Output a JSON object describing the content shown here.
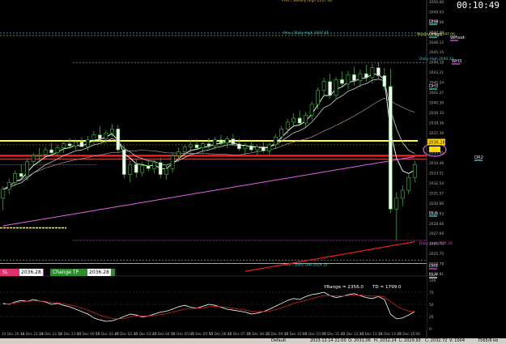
{
  "window": {
    "clock": "00:10:49",
    "header_label": "Prev / Weekly High 2037.06"
  },
  "price_levels": [
    {
      "label": "Prev / Daily High 2047.31",
      "color": "#3ec9c9"
    },
    {
      "label": "Weekly High 2047.06",
      "color": "#c8c832"
    },
    {
      "label": "Daily High 2044.33",
      "color": "#3ec9c9"
    },
    {
      "label": "Daily Low 2026.33",
      "color": "#e040e0"
    },
    {
      "label": "Prev / Daily Low 2024.33",
      "color": "#3ec9c9"
    }
  ],
  "pivot_labels": [
    {
      "label": "DH4"
    },
    {
      "label": "DHigh"
    },
    {
      "label": "WPivot"
    },
    {
      "label": "WH3"
    },
    {
      "label": "DH3"
    },
    {
      "label": "DR2"
    },
    {
      "label": "DL3"
    },
    {
      "label": "DR6"
    },
    {
      "label": "DL4"
    }
  ],
  "price_axis": {
    "ticks": [
      "2050.00",
      "2049.03",
      "2048.06",
      "2047.09",
      "2046.12",
      "2045.15",
      "2044.18",
      "2043.21",
      "2042.24",
      "2041.27",
      "2040.30",
      "2039.33",
      "2038.36",
      "2037.39",
      "2036.42",
      "2035.45",
      "2034.48",
      "2033.51",
      "2032.54",
      "2031.57",
      "2030.60",
      "2029.63",
      "2028.66",
      "2027.69",
      "2026.72",
      "2025.75",
      "2024.78",
      "2023.81"
    ],
    "current_price": "2036.28"
  },
  "orders": {
    "sl_label": "SL",
    "sl_price": "2036.28",
    "tp_label": "Change TP",
    "tp_price": "2036.28"
  },
  "indicator": {
    "range_text": "YRange = 2356.0",
    "td_text": "TD = 1799.0",
    "ticks": [
      "100",
      "75",
      "50",
      "25",
      "0"
    ]
  },
  "time_axis": [
    "14 Dec 20:30",
    "14 Dec 21:20",
    "14 Dec 22:10",
    "14 Dec 23:00",
    "15 Dec 00:50",
    "15 Dec 01:40",
    "15 Dec 02:30",
    "15 Dec 03:20",
    "15 Dec 04:10",
    "15 Dec 05:00",
    "15 Dec 05:50",
    "15 Dec 06:40",
    "15 Dec 07:30",
    "15 Dec 08:20",
    "15 Dec 09:10",
    "15 Dec 10:00",
    "15 Dec 10:50",
    "15 Dec 11:40",
    "15 Dec 12:30",
    "15 Dec 13:20",
    "15 Dec 14:10",
    "15 Dec 15:00"
  ],
  "status_bar": {
    "profile": "Default",
    "datetime": "2023.12.14 21:00",
    "open": "O: 2031.06",
    "high": "H: 2032.24",
    "low": "L: 2029.93",
    "close": "C: 2032.72",
    "volume": "V: 1004",
    "traffic": "7565/6 kb"
  },
  "chart_data": {
    "type": "candlestick",
    "series_note_colors": {
      "ema_fast": "#ffffff",
      "ema_slow": "#cccccc",
      "ma_long": "#e060e0",
      "ma_xlong": "#ff2020"
    },
    "ylim": [
      2023.3,
      2050.0
    ],
    "candles": [
      {
        "o": 2030.6,
        "h": 2031.8,
        "l": 2029.4,
        "c": 2031.5
      },
      {
        "o": 2031.5,
        "h": 2032.6,
        "l": 2031.0,
        "c": 2032.2
      },
      {
        "o": 2032.2,
        "h": 2033.4,
        "l": 2031.8,
        "c": 2033.1
      },
      {
        "o": 2033.1,
        "h": 2034.0,
        "l": 2032.5,
        "c": 2032.8
      },
      {
        "o": 2032.8,
        "h": 2034.6,
        "l": 2032.4,
        "c": 2034.3
      },
      {
        "o": 2034.3,
        "h": 2035.2,
        "l": 2033.9,
        "c": 2034.9
      },
      {
        "o": 2034.9,
        "h": 2035.7,
        "l": 2034.2,
        "c": 2035.0
      },
      {
        "o": 2035.0,
        "h": 2035.8,
        "l": 2034.6,
        "c": 2035.5
      },
      {
        "o": 2035.5,
        "h": 2036.2,
        "l": 2035.0,
        "c": 2035.2
      },
      {
        "o": 2035.2,
        "h": 2036.0,
        "l": 2034.8,
        "c": 2035.7
      },
      {
        "o": 2035.7,
        "h": 2036.4,
        "l": 2035.2,
        "c": 2036.1
      },
      {
        "o": 2036.1,
        "h": 2036.7,
        "l": 2035.6,
        "c": 2035.9
      },
      {
        "o": 2035.9,
        "h": 2036.6,
        "l": 2035.5,
        "c": 2036.3
      },
      {
        "o": 2036.3,
        "h": 2036.8,
        "l": 2035.8,
        "c": 2035.8
      },
      {
        "o": 2035.8,
        "h": 2036.9,
        "l": 2035.4,
        "c": 2036.5
      },
      {
        "o": 2036.5,
        "h": 2037.4,
        "l": 2036.0,
        "c": 2037.0
      },
      {
        "o": 2037.0,
        "h": 2037.9,
        "l": 2036.4,
        "c": 2036.6
      },
      {
        "o": 2036.6,
        "h": 2037.5,
        "l": 2036.1,
        "c": 2037.2
      },
      {
        "o": 2037.2,
        "h": 2038.1,
        "l": 2036.8,
        "c": 2037.6
      },
      {
        "o": 2037.6,
        "h": 2038.0,
        "l": 2035.2,
        "c": 2035.5
      },
      {
        "o": 2035.5,
        "h": 2035.9,
        "l": 2032.6,
        "c": 2033.0
      },
      {
        "o": 2033.0,
        "h": 2034.4,
        "l": 2032.2,
        "c": 2034.0
      },
      {
        "o": 2034.0,
        "h": 2034.5,
        "l": 2032.7,
        "c": 2033.2
      },
      {
        "o": 2033.2,
        "h": 2034.3,
        "l": 2032.8,
        "c": 2033.9
      },
      {
        "o": 2033.9,
        "h": 2034.6,
        "l": 2033.3,
        "c": 2033.6
      },
      {
        "o": 2033.6,
        "h": 2034.5,
        "l": 2033.1,
        "c": 2034.2
      },
      {
        "o": 2034.2,
        "h": 2034.7,
        "l": 2032.6,
        "c": 2033.0
      },
      {
        "o": 2033.0,
        "h": 2034.0,
        "l": 2032.5,
        "c": 2033.6
      },
      {
        "o": 2033.6,
        "h": 2035.2,
        "l": 2033.2,
        "c": 2034.9
      },
      {
        "o": 2034.9,
        "h": 2035.7,
        "l": 2034.3,
        "c": 2035.3
      },
      {
        "o": 2035.3,
        "h": 2036.0,
        "l": 2034.9,
        "c": 2035.8
      },
      {
        "o": 2035.8,
        "h": 2036.5,
        "l": 2035.2,
        "c": 2036.0
      },
      {
        "o": 2036.0,
        "h": 2036.6,
        "l": 2035.5,
        "c": 2035.7
      },
      {
        "o": 2035.7,
        "h": 2036.3,
        "l": 2035.2,
        "c": 2036.1
      },
      {
        "o": 2036.1,
        "h": 2036.7,
        "l": 2035.6,
        "c": 2035.9
      },
      {
        "o": 2035.9,
        "h": 2036.8,
        "l": 2035.5,
        "c": 2036.5
      },
      {
        "o": 2036.5,
        "h": 2037.0,
        "l": 2036.0,
        "c": 2036.2
      },
      {
        "o": 2036.2,
        "h": 2036.9,
        "l": 2035.7,
        "c": 2036.6
      },
      {
        "o": 2036.6,
        "h": 2037.1,
        "l": 2035.9,
        "c": 2036.1
      },
      {
        "o": 2036.1,
        "h": 2036.6,
        "l": 2035.4,
        "c": 2035.6
      },
      {
        "o": 2035.6,
        "h": 2036.2,
        "l": 2035.0,
        "c": 2035.9
      },
      {
        "o": 2035.9,
        "h": 2036.4,
        "l": 2035.3,
        "c": 2035.5
      },
      {
        "o": 2035.5,
        "h": 2036.0,
        "l": 2034.9,
        "c": 2035.8
      },
      {
        "o": 2035.8,
        "h": 2036.3,
        "l": 2035.2,
        "c": 2035.4
      },
      {
        "o": 2035.4,
        "h": 2036.2,
        "l": 2035.0,
        "c": 2036.0
      },
      {
        "o": 2036.0,
        "h": 2037.1,
        "l": 2035.6,
        "c": 2036.8
      },
      {
        "o": 2036.8,
        "h": 2037.9,
        "l": 2036.4,
        "c": 2037.6
      },
      {
        "o": 2037.6,
        "h": 2038.6,
        "l": 2037.1,
        "c": 2038.3
      },
      {
        "o": 2038.3,
        "h": 2039.2,
        "l": 2037.8,
        "c": 2038.7
      },
      {
        "o": 2038.7,
        "h": 2039.5,
        "l": 2038.0,
        "c": 2038.2
      },
      {
        "o": 2038.2,
        "h": 2039.3,
        "l": 2037.7,
        "c": 2039.0
      },
      {
        "o": 2039.0,
        "h": 2040.4,
        "l": 2038.5,
        "c": 2040.1
      },
      {
        "o": 2040.1,
        "h": 2041.8,
        "l": 2039.6,
        "c": 2041.5
      },
      {
        "o": 2041.5,
        "h": 2042.8,
        "l": 2040.9,
        "c": 2042.4
      },
      {
        "o": 2042.4,
        "h": 2043.2,
        "l": 2040.7,
        "c": 2041.0
      },
      {
        "o": 2041.0,
        "h": 2042.9,
        "l": 2040.6,
        "c": 2042.6
      },
      {
        "o": 2042.6,
        "h": 2043.4,
        "l": 2041.9,
        "c": 2042.2
      },
      {
        "o": 2042.2,
        "h": 2043.5,
        "l": 2041.6,
        "c": 2043.1
      },
      {
        "o": 2043.1,
        "h": 2043.9,
        "l": 2042.0,
        "c": 2042.5
      },
      {
        "o": 2042.5,
        "h": 2043.6,
        "l": 2041.8,
        "c": 2043.2
      },
      {
        "o": 2043.2,
        "h": 2044.1,
        "l": 2042.4,
        "c": 2042.8
      },
      {
        "o": 2042.8,
        "h": 2044.2,
        "l": 2042.2,
        "c": 2043.8
      },
      {
        "o": 2043.8,
        "h": 2044.3,
        "l": 2042.7,
        "c": 2043.0
      },
      {
        "o": 2043.0,
        "h": 2043.8,
        "l": 2041.5,
        "c": 2041.9
      },
      {
        "o": 2041.9,
        "h": 2043.7,
        "l": 2029.1,
        "c": 2029.5
      },
      {
        "o": 2029.5,
        "h": 2031.2,
        "l": 2026.3,
        "c": 2030.6
      },
      {
        "o": 2030.6,
        "h": 2031.9,
        "l": 2029.8,
        "c": 2031.4
      },
      {
        "o": 2031.4,
        "h": 2033.0,
        "l": 2031.0,
        "c": 2032.7
      },
      {
        "o": 2032.7,
        "h": 2034.4,
        "l": 2032.2,
        "c": 2034.0
      }
    ],
    "oscillator": [
      52,
      50,
      55,
      58,
      56,
      60,
      57,
      55,
      50,
      52,
      48,
      45,
      40,
      35,
      30,
      22,
      18,
      15,
      16,
      20,
      25,
      30,
      28,
      24,
      26,
      30,
      34,
      36,
      40,
      45,
      48,
      44,
      42,
      46,
      50,
      48,
      44,
      40,
      38,
      36,
      34,
      30,
      32,
      35,
      40,
      46,
      52,
      58,
      62,
      60,
      66,
      70,
      72,
      75,
      68,
      64,
      66,
      70,
      72,
      68,
      64,
      62,
      66,
      60,
      30,
      20,
      22,
      28,
      35
    ],
    "oscillator_signal": [
      50,
      51,
      53,
      55,
      56,
      57,
      57,
      56,
      54,
      53,
      51,
      49,
      46,
      42,
      38,
      33,
      28,
      24,
      21,
      20,
      21,
      24,
      26,
      26,
      26,
      27,
      29,
      31,
      34,
      37,
      40,
      41,
      42,
      43,
      45,
      46,
      45,
      44,
      42,
      40,
      38,
      36,
      35,
      35,
      36,
      39,
      43,
      47,
      52,
      55,
      58,
      62,
      65,
      68,
      68,
      67,
      67,
      68,
      69,
      69,
      68,
      67,
      67,
      65,
      56,
      47,
      40,
      36,
      35
    ]
  }
}
